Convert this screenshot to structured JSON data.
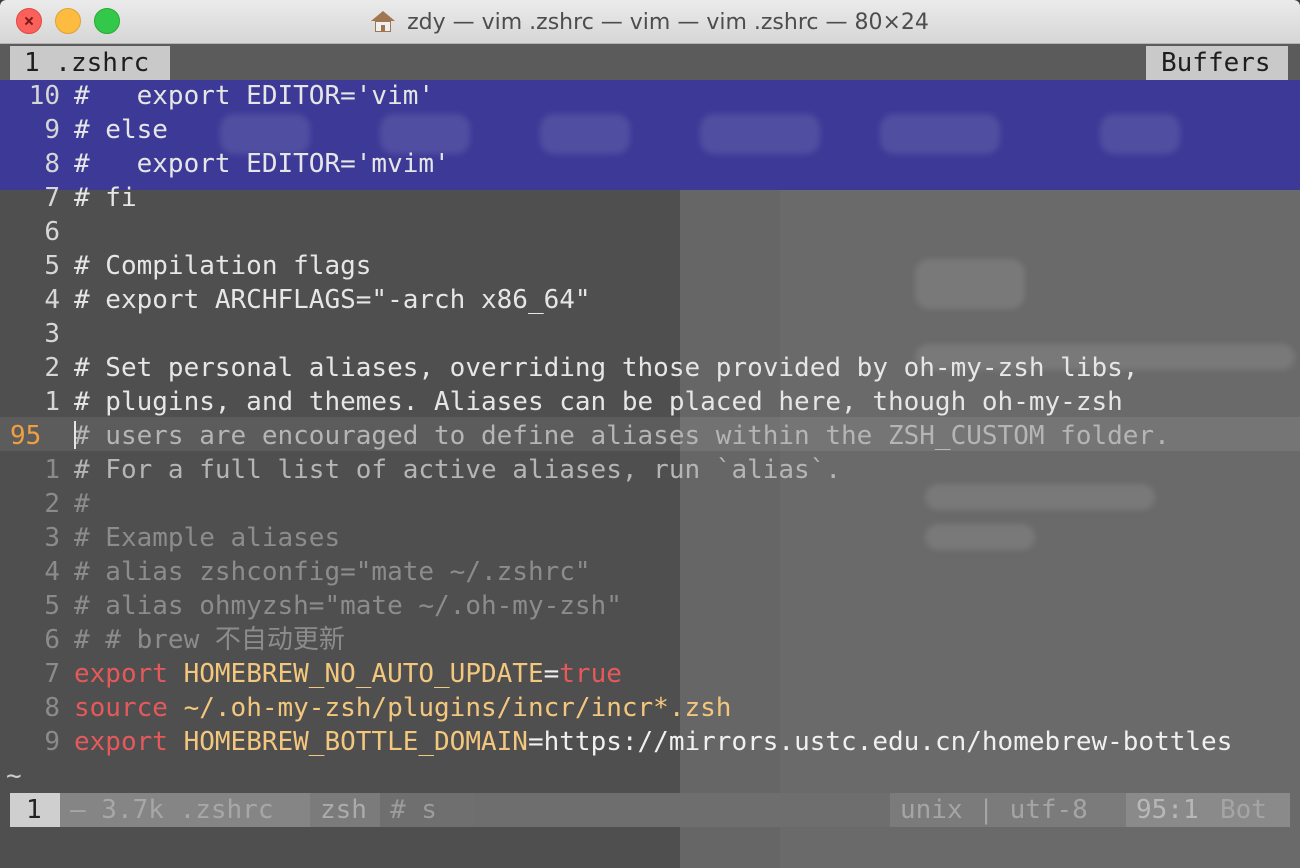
{
  "window": {
    "title": "zdy — vim .zshrc — vim — vim .zshrc — 80×24"
  },
  "tabline": {
    "active_tab": "1 .zshrc",
    "buffers_label": "Buffers"
  },
  "lines": [
    {
      "num": "10",
      "text": "#   export EDITOR='vim'"
    },
    {
      "num": "9",
      "text": "# else"
    },
    {
      "num": "8",
      "text": "#   export EDITOR='mvim'"
    },
    {
      "num": "7",
      "text": "# fi"
    },
    {
      "num": "6",
      "text": ""
    },
    {
      "num": "5",
      "text": "# Compilation flags"
    },
    {
      "num": "4",
      "text": "# export ARCHFLAGS=\"-arch x86_64\""
    },
    {
      "num": "3",
      "text": ""
    },
    {
      "num": "2",
      "text": "# Set personal aliases, overriding those provided by oh-my-zsh libs,"
    },
    {
      "num": "1",
      "text": "# plugins, and themes. Aliases can be placed here, though oh-my-zsh"
    },
    {
      "num": "95",
      "text": "# users are encouraged to define aliases within the ZSH_CUSTOM folder."
    },
    {
      "num": "1",
      "text": "# For a full list of active aliases, run `alias`."
    },
    {
      "num": "2",
      "text": "#"
    },
    {
      "num": "3",
      "text": "# Example aliases"
    },
    {
      "num": "4",
      "text": "# alias zshconfig=\"mate ~/.zshrc\""
    },
    {
      "num": "5",
      "text": "# alias ohmyzsh=\"mate ~/.oh-my-zsh\""
    },
    {
      "num": "6",
      "text": "# # brew 不自动更新"
    },
    {
      "num": "7",
      "kw": "export",
      "rest_id": "HOMEBREW_NO_AUTO_UPDATE",
      "rest_eq": "=",
      "rest_val": "true"
    },
    {
      "num": "8",
      "kw": "source",
      "rest_txt": "~/.oh-my-zsh/plugins/incr/incr*.zsh"
    },
    {
      "num": "9",
      "kw": "export",
      "rest_id": "HOMEBREW_BOTTLE_DOMAIN",
      "rest_eq": "=",
      "rest_txt": "https://mirrors.ustc.edu.cn/homebrew-bottles"
    }
  ],
  "tilde": "~",
  "statusline": {
    "mode": "1",
    "file": "– 3.7k .zshrc",
    "filetype": "zsh",
    "tag": "# s",
    "encoding": "unix | utf-8",
    "position": "95:1",
    "scroll": "Bot"
  },
  "colors": {
    "keyword": "#e5595b",
    "identifier": "#f3c77d",
    "current_line_number": "#f0a040",
    "tab_bg": "#c9c9c9"
  }
}
